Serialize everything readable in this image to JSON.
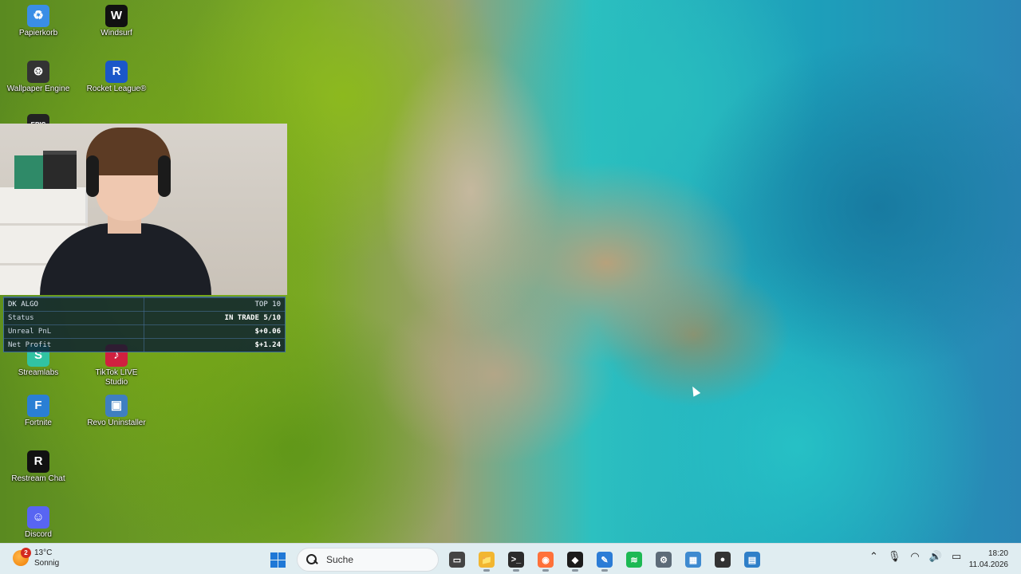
{
  "desktop_icons": [
    {
      "name": "desktop-icon-recycle-bin",
      "label": "Papierkorb",
      "glyph": "♻",
      "color": "#3a8ee6"
    },
    {
      "name": "desktop-icon-windsurf",
      "label": "Windsurf",
      "glyph": "W",
      "color": "#111111"
    },
    {
      "name": "desktop-icon-wallpaper-engine",
      "label": "Wallpaper Engine",
      "glyph": "⊛",
      "color": "#333333"
    },
    {
      "name": "desktop-icon-rocket-league",
      "label": "Rocket League®",
      "glyph": "R",
      "color": "#1b57c9"
    },
    {
      "name": "desktop-icon-epic-games",
      "label": "",
      "glyph": "EPIC",
      "color": "#222222"
    },
    {
      "name": "desktop-icon-streamlabs",
      "label": "Streamlabs",
      "glyph": "S",
      "color": "#31c3a2"
    },
    {
      "name": "desktop-icon-tiktok-live-studio",
      "label": "TikTok LIVE Studio",
      "glyph": "♪",
      "color": "#d0203f"
    },
    {
      "name": "desktop-icon-fortnite",
      "label": "Fortnite",
      "glyph": "F",
      "color": "#2a7fd4"
    },
    {
      "name": "desktop-icon-revo-uninstaller",
      "label": "Revo Uninstaller",
      "glyph": "▣",
      "color": "#3f7fc0"
    },
    {
      "name": "desktop-icon-restream-chat",
      "label": "Restream Chat",
      "glyph": "R",
      "color": "#111111"
    },
    {
      "name": "desktop-icon-discord",
      "label": "Discord",
      "glyph": "☺",
      "color": "#5865f2"
    }
  ],
  "algo_panel": {
    "title": "DK ALGO",
    "rank": "TOP 10",
    "rows": [
      {
        "label": "Status",
        "value": "IN TRADE 5/10"
      },
      {
        "label": "Unreal PnL",
        "value": "$+0.06"
      },
      {
        "label": "Net Profit",
        "value": "$+1.24"
      }
    ]
  },
  "taskbar": {
    "weather": {
      "badge": "2",
      "temp": "13°C",
      "condition": "Sonnig"
    },
    "search_placeholder": "Suche",
    "apps": [
      {
        "name": "task-view",
        "glyph": "▭",
        "color": "#444444"
      },
      {
        "name": "file-explorer",
        "glyph": "📁",
        "color": "#f2b630"
      },
      {
        "name": "terminal",
        "glyph": ">_",
        "color": "#2b2b2b"
      },
      {
        "name": "firefox",
        "glyph": "◉",
        "color": "#ff7139"
      },
      {
        "name": "app-black",
        "glyph": "◆",
        "color": "#1c1c1c"
      },
      {
        "name": "paint",
        "glyph": "✎",
        "color": "#2b7cd6"
      },
      {
        "name": "spotify",
        "glyph": "≋",
        "color": "#1db954"
      },
      {
        "name": "settings",
        "glyph": "⚙",
        "color": "#5d6b78"
      },
      {
        "name": "control-panel",
        "glyph": "▦",
        "color": "#3e8ad0"
      },
      {
        "name": "obs",
        "glyph": "●",
        "color": "#333333"
      },
      {
        "name": "taskmgr",
        "glyph": "▤",
        "color": "#2f7fc8"
      }
    ],
    "tray_icons": [
      "chevron-up-icon",
      "microphone-icon",
      "wifi-icon",
      "volume-icon",
      "battery-icon"
    ],
    "clock": {
      "time": "18:20",
      "date": "11.04.2026"
    }
  }
}
